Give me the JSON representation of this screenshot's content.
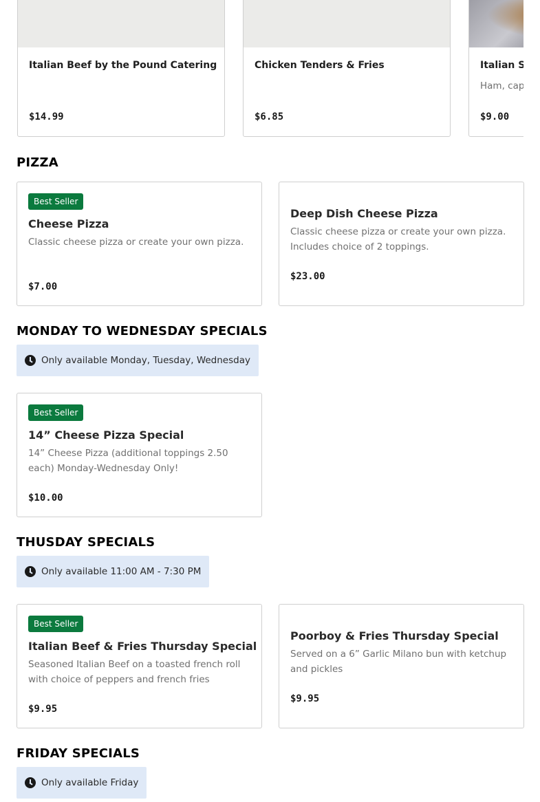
{
  "carousel": {
    "items": [
      {
        "title": "Italian Beef by the Pound Catering",
        "description": "",
        "price": "$14.99",
        "image": "placeholder"
      },
      {
        "title": "Chicken Tenders & Fries",
        "description": "",
        "price": "$6.85",
        "image": "placeholder"
      },
      {
        "title": "Italian Su",
        "description": "Ham, capi cheese, Ita",
        "price": "$9.00",
        "image": "photo"
      }
    ]
  },
  "sections": {
    "pizza": {
      "heading": "PIZZA",
      "items": [
        {
          "badge": "Best Seller",
          "title": "Cheese Pizza",
          "description": "Classic cheese pizza or create your own pizza.",
          "price": "$7.00"
        },
        {
          "badge": "",
          "title": "Deep Dish Cheese Pizza",
          "description": "Classic cheese pizza or create your own pizza. Includes choice of 2 toppings.",
          "price": "$23.00"
        }
      ]
    },
    "mon_wed": {
      "heading": "MONDAY TO WEDNESDAY SPECIALS",
      "availability": "Only available Monday, Tuesday, Wednesday",
      "items": [
        {
          "badge": "Best Seller",
          "title": "14” Cheese Pizza Special",
          "description": "14” Cheese Pizza (additional toppings 2.50 each) Monday-Wednesday Only!",
          "price": "$10.00"
        }
      ]
    },
    "thursday": {
      "heading": "THUSDAY SPECIALS",
      "availability": "Only available 11:00 AM - 7:30 PM",
      "items": [
        {
          "badge": "Best Seller",
          "title": "Italian Beef & Fries Thursday Special",
          "description": "Seasoned Italian Beef on a toasted french roll with choice of peppers and french fries",
          "price": "$9.95"
        },
        {
          "badge": "",
          "title": "Poorboy & Fries Thursday Special",
          "description": "Served on a 6” Garlic Milano bun with ketchup and pickles",
          "price": "$9.95"
        }
      ]
    },
    "friday": {
      "heading": "FRIDAY SPECIALS",
      "availability": "Only available Friday"
    }
  },
  "colors": {
    "badge": "#0b7a3e",
    "availability_bg": "#dfe9f7",
    "card_border": "#cfcfcf"
  },
  "icons": {
    "availability": "clock-icon"
  }
}
